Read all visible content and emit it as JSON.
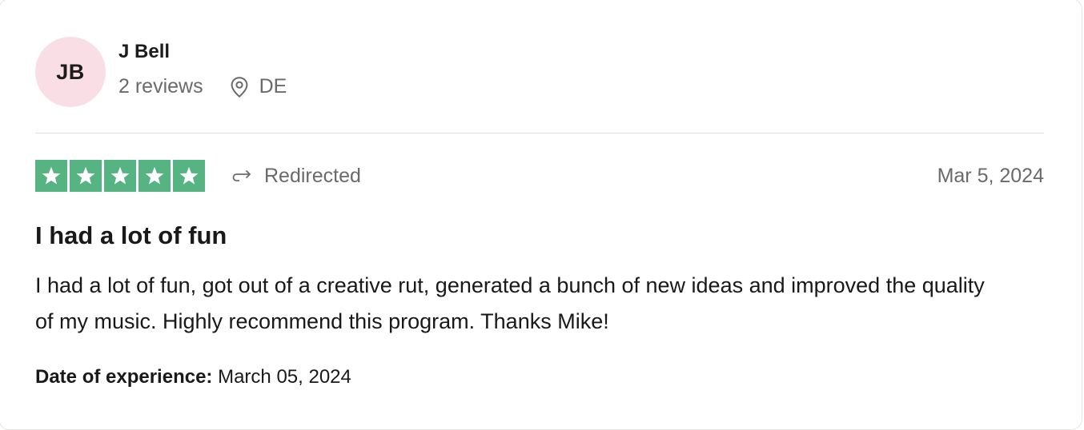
{
  "consumer": {
    "initials": "JB",
    "name": "J Bell",
    "reviews": "2 reviews",
    "country": "DE",
    "avatar_color": "#f9dfe5"
  },
  "review": {
    "stars": 5,
    "stars_max": 5,
    "star_color": "#55b482",
    "source": "Redirected",
    "date": "Mar 5, 2024",
    "title": "I had a lot of fun",
    "text": "I had a lot of fun, got out of a creative rut, generated a bunch of new ideas and improved the quality of my music. Highly recommend this program. Thanks Mike!",
    "experience_label": "Date of experience:",
    "experience_date": "March 05, 2024"
  },
  "icons": {
    "location": "map-pin-icon",
    "source": "redirect-arrow-icon",
    "rating": "star-icon"
  }
}
